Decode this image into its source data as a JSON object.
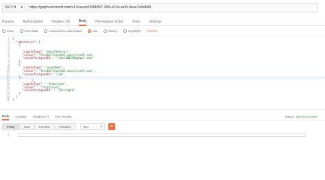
{
  "request": {
    "method": "PATCH",
    "url": "https://graph.microsoft.com/v1.0/users/00889f37-305f-421d-ae96-8aec7a3d3bf9"
  },
  "request_tabs": [
    "Params",
    "Authorization",
    "Headers (9)",
    "Body",
    "Pre-request Script",
    "Tests",
    "Settings"
  ],
  "active_request_tab": "Body",
  "body_options": [
    {
      "label": "none",
      "selected": false
    },
    {
      "label": "form-data",
      "selected": false
    },
    {
      "label": "x-www-form-urlencoded",
      "selected": false
    },
    {
      "label": "raw",
      "selected": true
    },
    {
      "label": "binary",
      "selected": false
    },
    {
      "label": "GraphQL",
      "selected": false
    }
  ],
  "body_format": "JSON",
  "editor_lines": [
    {
      "n": "1",
      "code": "{",
      "hl": false
    },
    {
      "n": "2",
      "code": "  \"identities\": [",
      "hl": false
    },
    {
      "n": "3",
      "code": "    {",
      "hl": false
    },
    {
      "n": "4",
      "code": "",
      "hl": false
    },
    {
      "n": "5",
      "code": "      \"signInType\": \"emailAddress\",",
      "hl": false
    },
    {
      "n": "6",
      "code": "      \"issuer\": \"Test01CTenant05.onmicrosoft.com\",",
      "hl": false
    },
    {
      "n": "7",
      "code": "      \"issuerAssignedId\": \"jlmus100545@gmail.com\"",
      "hl": false
    },
    {
      "n": "8",
      "code": "    },",
      "hl": false
    },
    {
      "n": "9",
      "code": "    {",
      "hl": false
    },
    {
      "n": "10",
      "code": "      \"signInType\": \"userName\",",
      "hl": false
    },
    {
      "n": "11",
      "code": "      \"issuer\": \"Test01CTenant05.onmicrosoft.com\",",
      "hl": false
    },
    {
      "n": "12",
      "code": "      \"issuerAssignedId\": \"jlm\"",
      "hl": false
    },
    {
      "n": "13",
      "code": "    },",
      "hl": true
    },
    {
      "n": "14",
      "code": "            {",
      "hl": false
    },
    {
      "n": "15",
      "code": "      \"signInType\" : \"federated\",",
      "hl": false
    },
    {
      "n": "16",
      "code": "      \"issuer\" : \"TestIssuer\",",
      "hl": false
    },
    {
      "n": "17",
      "code": "      \"issuerAssignedId\" : \"TestingId\"",
      "hl": false
    },
    {
      "n": "18",
      "code": "    }",
      "hl": false
    },
    {
      "n": "19",
      "code": "  ]",
      "hl": false
    },
    {
      "n": "20",
      "code": "}",
      "hl": false
    }
  ],
  "response_tabs": [
    "Body",
    "Cookies",
    "Headers (7)",
    "Test Results"
  ],
  "active_response_tab": "Body",
  "status": {
    "label": "Status:",
    "value": "204 No Content"
  },
  "view_modes": [
    "Pretty",
    "Raw",
    "Preview",
    "Visualize"
  ],
  "active_view_mode": "Pretty",
  "text_format": "Text",
  "response_line_number": "1",
  "colors": {
    "accent": "#f26b3a",
    "status_ok": "#2a9d3a"
  },
  "icons": {
    "dropdown": "chevron-down-icon",
    "wrap": "wrap-lines-icon"
  }
}
